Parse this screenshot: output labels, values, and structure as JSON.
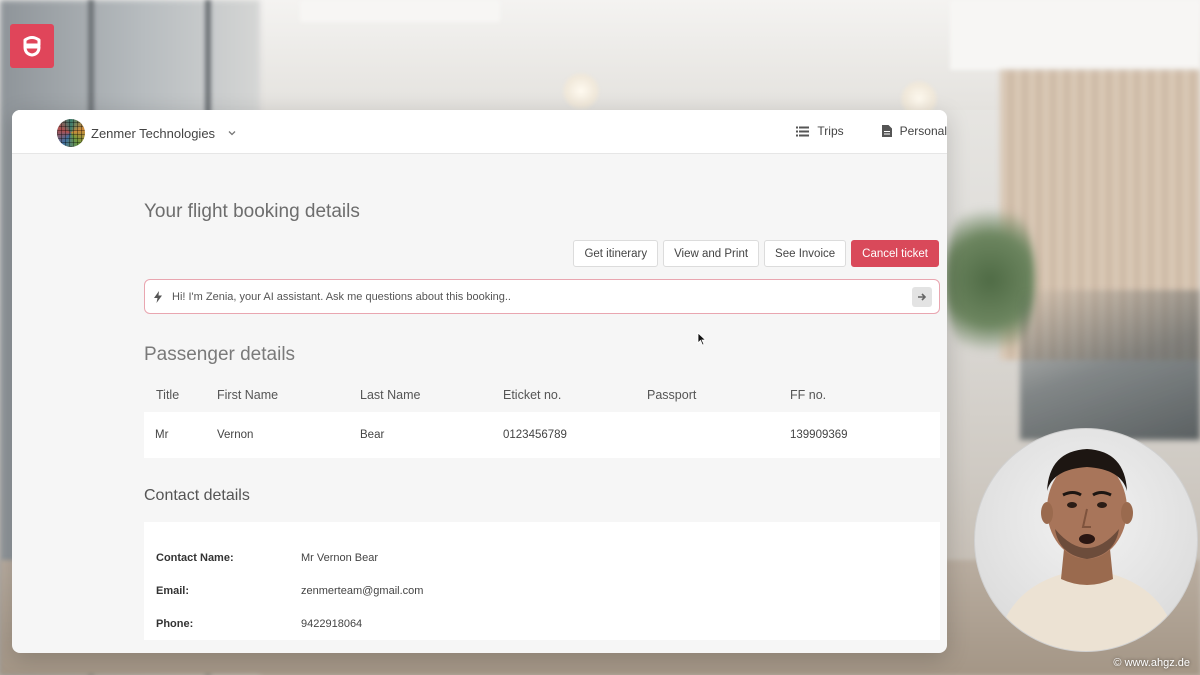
{
  "header": {
    "org_name": "Zenmer Technologies",
    "nav": [
      {
        "label": "Trips",
        "icon": "list-icon"
      },
      {
        "label": "Personal",
        "icon": "document-icon"
      }
    ]
  },
  "page": {
    "title": "Your flight booking details",
    "actions": [
      {
        "label": "Get itinerary"
      },
      {
        "label": "View and Print"
      },
      {
        "label": "See Invoice"
      },
      {
        "label": "Cancel ticket",
        "style": "danger"
      }
    ],
    "assistant": {
      "placeholder": "Hi! I'm Zenia, your AI assistant. Ask me questions about this booking.."
    }
  },
  "passenger": {
    "title": "Passenger details",
    "columns": [
      "Title",
      "First Name",
      "Last Name",
      "Eticket no.",
      "Passport",
      "FF no."
    ],
    "rows": [
      [
        "Mr",
        "Vernon",
        "Bear",
        "0123456789",
        "",
        "139909369"
      ]
    ]
  },
  "contact": {
    "title": "Contact details",
    "fields": [
      {
        "label": "Contact Name:",
        "value": "Mr Vernon Bear"
      },
      {
        "label": "Email:",
        "value": "zenmerteam@gmail.com"
      },
      {
        "label": "Phone:",
        "value": "9422918064"
      }
    ]
  },
  "watermark": "© www.ahgz.de",
  "colors": {
    "accent": "#d9495a",
    "brand_badge": "#e0455a",
    "assistant_border": "#e9a6b0"
  }
}
